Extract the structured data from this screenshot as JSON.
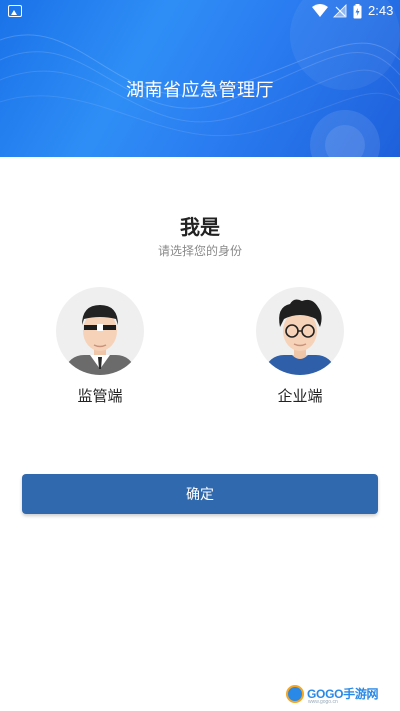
{
  "status_bar": {
    "time": "2:43",
    "icons": [
      "gallery-icon",
      "wifi-icon",
      "signal-icon",
      "battery-icon"
    ]
  },
  "header": {
    "title": "湖南省应急管理厅"
  },
  "main": {
    "heading": "我是",
    "subheading": "请选择您的身份",
    "roles": [
      {
        "label": "监管端",
        "icon": "supervisor-avatar-icon"
      },
      {
        "label": "企业端",
        "icon": "enterprise-avatar-icon"
      }
    ],
    "confirm_label": "确定"
  },
  "watermark": {
    "brand": "GOGO手游网",
    "sub": "www.gogo.cn"
  },
  "colors": {
    "header_blue": "#2a7cf0",
    "button_blue": "#3069ad",
    "heading_text": "#222222",
    "sub_text": "#8a8a8a"
  }
}
